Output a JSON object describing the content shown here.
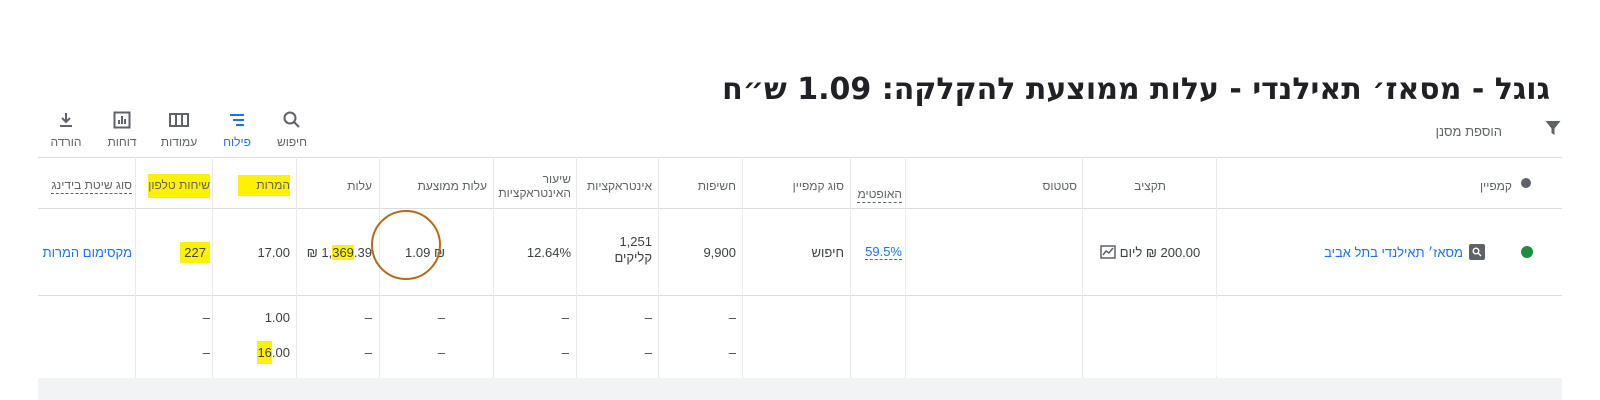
{
  "page_title": "גוגל - מסאז׳ תאילנדי - עלות ממוצעת להקלקה: 1.09 ש״ח",
  "toolbar": {
    "download": "הורדה",
    "reports": "דוחות",
    "columns": "עמודות",
    "segment": "פילוח",
    "search": "חיפוש",
    "add_filter": "הוספת מסנן"
  },
  "columns": {
    "campaign": "קמפיין",
    "budget": "תקציב",
    "status": "סטטוס",
    "optimization": "האופטימ",
    "campaign_type": "סוג קמפיין",
    "impressions": "חשיפות",
    "interactions": "אינטראקציות",
    "interaction_rate": "שיעור האינטראקציות",
    "avg_cost": "עלות ממוצעת",
    "cost": "עלות",
    "conversions": "המרות",
    "phone_calls": "שיחות טלפון",
    "bid_strategy_type": "סוג שיטת בידינג"
  },
  "row": {
    "campaign_name": "מסאז׳ תאילנדי בתל אביב",
    "budget": "200.00 ₪ ליום",
    "optimization_score": "59.5%",
    "campaign_type": "חיפוש",
    "impressions": "9,900",
    "interactions_value": "1,251",
    "interactions_unit": "קליקים",
    "interaction_rate": "12.64%",
    "avg_cost": "₪ 1.09",
    "cost_prefix": "₪ 1,",
    "cost_highlight": "369",
    "cost_suffix": ".39",
    "conversions": "17.00",
    "phone_calls": "227",
    "bid_strategy": "מקסימום המרות"
  },
  "subrows": [
    {
      "phone_calls": "–",
      "conversions": "1.00",
      "cost": "–",
      "avg_cost": "–",
      "interaction_rate": "–",
      "interactions": "–",
      "impressions": "–"
    },
    {
      "phone_calls": "–",
      "conversions_highlight": "16",
      "conversions_suffix": ".00",
      "cost": "–",
      "avg_cost": "–",
      "interaction_rate": "–",
      "interactions": "–",
      "impressions": "–"
    }
  ],
  "colors": {
    "accent": "#1a73e8",
    "highlight": "#fff200",
    "status_enabled": "#1e8e3e",
    "annotation_circle": "#b36a1a"
  },
  "icons": [
    "download-icon",
    "reports-icon",
    "columns-icon",
    "segment-icon",
    "search-icon",
    "filter-icon",
    "search-campaign-icon",
    "trend-chart-icon"
  ]
}
